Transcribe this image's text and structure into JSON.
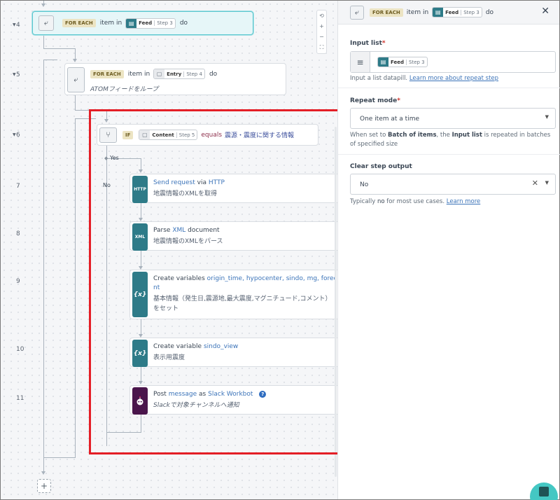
{
  "steps": [
    {
      "num": "4",
      "kw": "FOR EACH",
      "t1": "item in",
      "pill_name": "Feed",
      "pill_step": "Step 3",
      "t2": "do",
      "sub": ""
    },
    {
      "num": "5",
      "kw": "FOR EACH",
      "t1": "item in",
      "pill_name": "Entry",
      "pill_step": "Step 4",
      "t2": "do",
      "sub": "ATOMフィードをループ"
    },
    {
      "num": "6",
      "kw": "IF",
      "pill_name": "Content",
      "pill_step": "Step 5",
      "op": "equals",
      "val": "震源・震度に関する情報"
    },
    {
      "num": "7",
      "icon_text": "HTTP",
      "action": "Send request",
      "conn": "via",
      "app": "HTTP",
      "sub": "地震情報のXMLを取得"
    },
    {
      "num": "8",
      "icon_text": "XML",
      "action": "Parse",
      "app": "XML",
      "after": "document",
      "sub": "地震情報のXMLをパース"
    },
    {
      "num": "9",
      "icon_text": "{x}",
      "action": "Create variables",
      "vars_line1": "origin_time, hypocenter, sindo, mg, forecast_comme",
      "vars_line2": "nt",
      "sub1": "基本情報（発生日,震源地,最大震度,マグニチュード,コメント）",
      "sub2": "をセット"
    },
    {
      "num": "10",
      "icon_text": "{x}",
      "action": "Create variable",
      "var": "sindo_view",
      "sub": "表示用震度"
    },
    {
      "num": "11",
      "icon_text": "",
      "action": "Post",
      "action2": "message",
      "conn": "as",
      "app": "Slack Workbot",
      "sub": "Slackで対象チャンネルへ通知"
    }
  ],
  "branch": {
    "yes": "Yes",
    "no": "No"
  },
  "zoom": {
    "reset": "⟲",
    "plus": "+",
    "minus": "−",
    "fit": "⛶"
  },
  "add_step": "+",
  "panel": {
    "kw": "FOR EACH",
    "t1": "item in",
    "pill_name": "Feed",
    "pill_step": "Step 3",
    "t2": "do",
    "close": "✕",
    "input_list": {
      "label": "Input list",
      "pill_name": "Feed",
      "pill_step": "Step 3",
      "help_text": "Input a list datapill.",
      "help_link": "Learn more about repeat step"
    },
    "repeat_mode": {
      "label": "Repeat mode",
      "value": "One item at a time",
      "help_1": "When set to",
      "help_b1": "Batch of items",
      "help_2": ", the",
      "help_b2": "Input list",
      "help_3": "is repeated in batches of specified size"
    },
    "clear_output": {
      "label": "Clear step output",
      "value": "No",
      "help_1": "Typically",
      "help_b": "no",
      "help_2": "for most use cases.",
      "help_link": "Learn more"
    }
  },
  "colors": {
    "accent": "#44c7c3",
    "highlight": "#e41e26",
    "app_teal": "#2e7b88",
    "slack": "#4a154b"
  }
}
